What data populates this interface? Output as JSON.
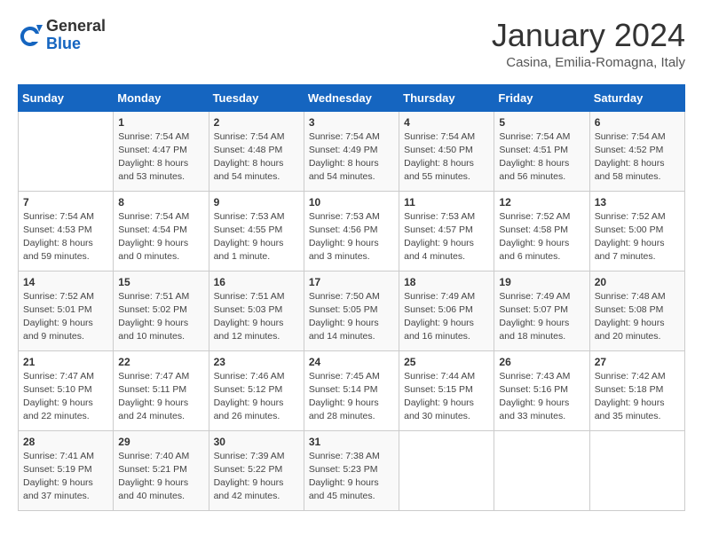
{
  "header": {
    "logo_general": "General",
    "logo_blue": "Blue",
    "month_title": "January 2024",
    "location": "Casina, Emilia-Romagna, Italy"
  },
  "days_of_week": [
    "Sunday",
    "Monday",
    "Tuesday",
    "Wednesday",
    "Thursday",
    "Friday",
    "Saturday"
  ],
  "weeks": [
    [
      {
        "day": "",
        "info": ""
      },
      {
        "day": "1",
        "info": "Sunrise: 7:54 AM\nSunset: 4:47 PM\nDaylight: 8 hours\nand 53 minutes."
      },
      {
        "day": "2",
        "info": "Sunrise: 7:54 AM\nSunset: 4:48 PM\nDaylight: 8 hours\nand 54 minutes."
      },
      {
        "day": "3",
        "info": "Sunrise: 7:54 AM\nSunset: 4:49 PM\nDaylight: 8 hours\nand 54 minutes."
      },
      {
        "day": "4",
        "info": "Sunrise: 7:54 AM\nSunset: 4:50 PM\nDaylight: 8 hours\nand 55 minutes."
      },
      {
        "day": "5",
        "info": "Sunrise: 7:54 AM\nSunset: 4:51 PM\nDaylight: 8 hours\nand 56 minutes."
      },
      {
        "day": "6",
        "info": "Sunrise: 7:54 AM\nSunset: 4:52 PM\nDaylight: 8 hours\nand 58 minutes."
      }
    ],
    [
      {
        "day": "7",
        "info": "Sunrise: 7:54 AM\nSunset: 4:53 PM\nDaylight: 8 hours\nand 59 minutes."
      },
      {
        "day": "8",
        "info": "Sunrise: 7:54 AM\nSunset: 4:54 PM\nDaylight: 9 hours\nand 0 minutes."
      },
      {
        "day": "9",
        "info": "Sunrise: 7:53 AM\nSunset: 4:55 PM\nDaylight: 9 hours\nand 1 minute."
      },
      {
        "day": "10",
        "info": "Sunrise: 7:53 AM\nSunset: 4:56 PM\nDaylight: 9 hours\nand 3 minutes."
      },
      {
        "day": "11",
        "info": "Sunrise: 7:53 AM\nSunset: 4:57 PM\nDaylight: 9 hours\nand 4 minutes."
      },
      {
        "day": "12",
        "info": "Sunrise: 7:52 AM\nSunset: 4:58 PM\nDaylight: 9 hours\nand 6 minutes."
      },
      {
        "day": "13",
        "info": "Sunrise: 7:52 AM\nSunset: 5:00 PM\nDaylight: 9 hours\nand 7 minutes."
      }
    ],
    [
      {
        "day": "14",
        "info": "Sunrise: 7:52 AM\nSunset: 5:01 PM\nDaylight: 9 hours\nand 9 minutes."
      },
      {
        "day": "15",
        "info": "Sunrise: 7:51 AM\nSunset: 5:02 PM\nDaylight: 9 hours\nand 10 minutes."
      },
      {
        "day": "16",
        "info": "Sunrise: 7:51 AM\nSunset: 5:03 PM\nDaylight: 9 hours\nand 12 minutes."
      },
      {
        "day": "17",
        "info": "Sunrise: 7:50 AM\nSunset: 5:05 PM\nDaylight: 9 hours\nand 14 minutes."
      },
      {
        "day": "18",
        "info": "Sunrise: 7:49 AM\nSunset: 5:06 PM\nDaylight: 9 hours\nand 16 minutes."
      },
      {
        "day": "19",
        "info": "Sunrise: 7:49 AM\nSunset: 5:07 PM\nDaylight: 9 hours\nand 18 minutes."
      },
      {
        "day": "20",
        "info": "Sunrise: 7:48 AM\nSunset: 5:08 PM\nDaylight: 9 hours\nand 20 minutes."
      }
    ],
    [
      {
        "day": "21",
        "info": "Sunrise: 7:47 AM\nSunset: 5:10 PM\nDaylight: 9 hours\nand 22 minutes."
      },
      {
        "day": "22",
        "info": "Sunrise: 7:47 AM\nSunset: 5:11 PM\nDaylight: 9 hours\nand 24 minutes."
      },
      {
        "day": "23",
        "info": "Sunrise: 7:46 AM\nSunset: 5:12 PM\nDaylight: 9 hours\nand 26 minutes."
      },
      {
        "day": "24",
        "info": "Sunrise: 7:45 AM\nSunset: 5:14 PM\nDaylight: 9 hours\nand 28 minutes."
      },
      {
        "day": "25",
        "info": "Sunrise: 7:44 AM\nSunset: 5:15 PM\nDaylight: 9 hours\nand 30 minutes."
      },
      {
        "day": "26",
        "info": "Sunrise: 7:43 AM\nSunset: 5:16 PM\nDaylight: 9 hours\nand 33 minutes."
      },
      {
        "day": "27",
        "info": "Sunrise: 7:42 AM\nSunset: 5:18 PM\nDaylight: 9 hours\nand 35 minutes."
      }
    ],
    [
      {
        "day": "28",
        "info": "Sunrise: 7:41 AM\nSunset: 5:19 PM\nDaylight: 9 hours\nand 37 minutes."
      },
      {
        "day": "29",
        "info": "Sunrise: 7:40 AM\nSunset: 5:21 PM\nDaylight: 9 hours\nand 40 minutes."
      },
      {
        "day": "30",
        "info": "Sunrise: 7:39 AM\nSunset: 5:22 PM\nDaylight: 9 hours\nand 42 minutes."
      },
      {
        "day": "31",
        "info": "Sunrise: 7:38 AM\nSunset: 5:23 PM\nDaylight: 9 hours\nand 45 minutes."
      },
      {
        "day": "",
        "info": ""
      },
      {
        "day": "",
        "info": ""
      },
      {
        "day": "",
        "info": ""
      }
    ]
  ]
}
